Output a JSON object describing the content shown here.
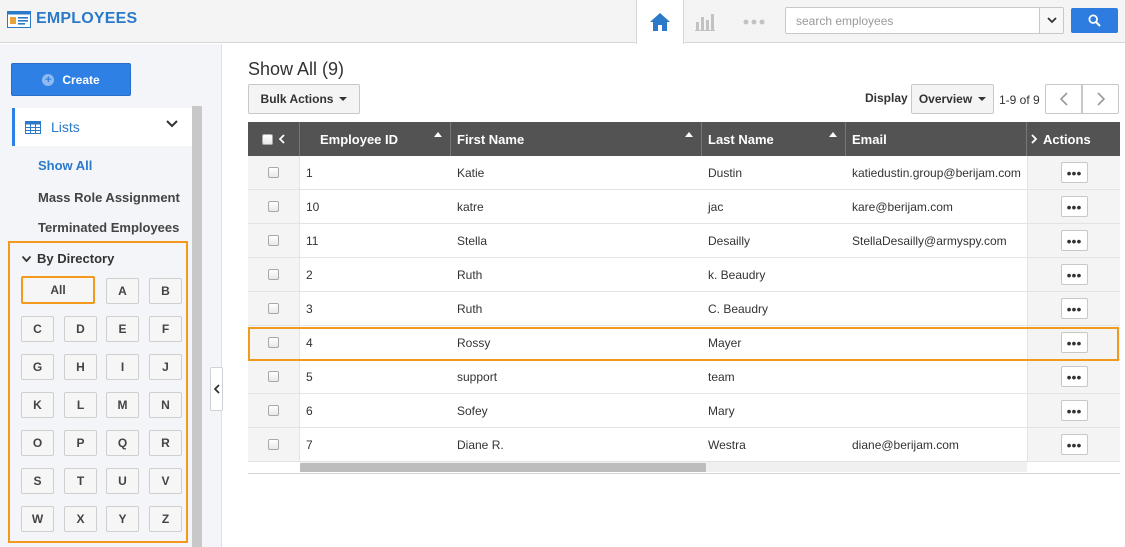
{
  "app": {
    "title": "EMPLOYEES"
  },
  "topnav": {
    "search_placeholder": "search employees"
  },
  "sidebar": {
    "create_label": "Create",
    "lists_label": "Lists",
    "links": [
      {
        "label": "Show All",
        "active": true
      },
      {
        "label": "Mass Role Assignment",
        "active": false
      },
      {
        "label": "Terminated Employees",
        "active": false
      }
    ],
    "directory": {
      "title": "By Directory",
      "all_label": "All",
      "letters": [
        "A",
        "B",
        "C",
        "D",
        "E",
        "F",
        "G",
        "H",
        "I",
        "J",
        "K",
        "L",
        "M",
        "N",
        "O",
        "P",
        "Q",
        "R",
        "S",
        "T",
        "U",
        "V",
        "W",
        "X",
        "Y",
        "Z"
      ]
    }
  },
  "main": {
    "title": "Show All (9)",
    "bulk_actions_label": "Bulk Actions",
    "display_label": "Display",
    "display_value": "Overview",
    "pager_text": "1-9 of 9"
  },
  "table": {
    "columns": [
      "Employee ID",
      "First Name",
      "Last Name",
      "Email",
      "Actions"
    ],
    "rows": [
      {
        "id": "1",
        "first": "Katie",
        "last": "Dustin",
        "email": "katiedustin.group@berijam.com"
      },
      {
        "id": "10",
        "first": "katre",
        "last": "jac",
        "email": "kare@berijam.com"
      },
      {
        "id": "11",
        "first": "Stella",
        "last": "Desailly",
        "email": "StellaDesailly@armyspy.com"
      },
      {
        "id": "2",
        "first": "Ruth",
        "last": "k. Beaudry",
        "email": ""
      },
      {
        "id": "3",
        "first": "Ruth",
        "last": "C. Beaudry",
        "email": ""
      },
      {
        "id": "4",
        "first": "Rossy",
        "last": "Mayer",
        "email": ""
      },
      {
        "id": "5",
        "first": "support",
        "last": "team",
        "email": ""
      },
      {
        "id": "6",
        "first": "Sofey",
        "last": "Mary",
        "email": ""
      },
      {
        "id": "7",
        "first": "Diane R.",
        "last": "Westra",
        "email": "diane@berijam.com"
      }
    ],
    "actions_glyph": "•••"
  },
  "colors": {
    "brand_blue": "#2b7ac9",
    "button_blue": "#2f80e4",
    "highlight_orange": "#f39a1e",
    "header_dark": "#535353"
  }
}
